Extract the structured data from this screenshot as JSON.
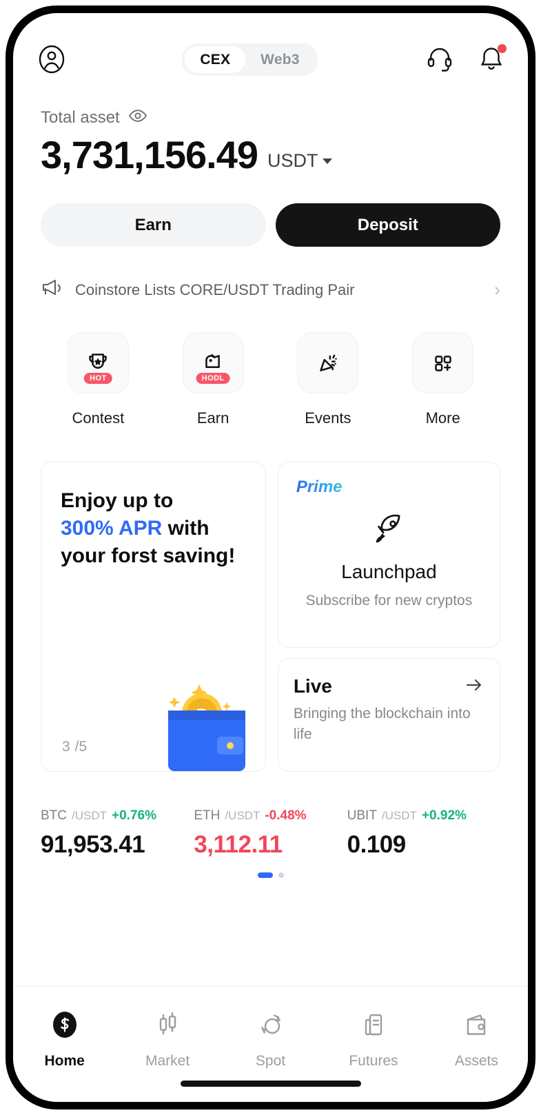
{
  "topbar": {
    "profile_icon": "user-circle-icon",
    "segments": [
      {
        "label": "CEX",
        "active": true
      },
      {
        "label": "Web3",
        "active": false
      }
    ],
    "support_icon": "headset-icon",
    "notification_icon": "bell-icon",
    "notification_badge": true
  },
  "asset": {
    "label": "Total asset",
    "visibility_icon": "eye-icon",
    "amount": "3,731,156.49",
    "currency": "USDT",
    "currency_caret": "chevron-down-icon"
  },
  "actions": {
    "earn_label": "Earn",
    "deposit_label": "Deposit"
  },
  "announcement": {
    "icon": "megaphone-icon",
    "text": "Coinstore Lists CORE/USDT Trading Pair",
    "chevron": "›"
  },
  "quick_actions": [
    {
      "label": "Contest",
      "icon": "trophy-icon",
      "badge": "HOT"
    },
    {
      "label": "Earn",
      "icon": "piggy-bank-icon",
      "badge": "HODL"
    },
    {
      "label": "Events",
      "icon": "party-popper-icon",
      "badge": ""
    },
    {
      "label": "More",
      "icon": "grid-plus-icon",
      "badge": ""
    }
  ],
  "promo_left": {
    "line1": "Enjoy up to",
    "highlight": "300% APR",
    "line2_tail": " with",
    "line3": "your forst saving!",
    "illustration": "wallet-bitcoin-illustration",
    "counter_current": "3",
    "counter_total": "/5"
  },
  "launchpad": {
    "tag": "Prime",
    "icon": "rocket-icon",
    "title": "Launchpad",
    "subtitle": "Subscribe for new cryptos"
  },
  "live": {
    "title": "Live",
    "arrow_icon": "arrow-right-icon",
    "subtitle": "Bringing the blockchain into life"
  },
  "tickers": [
    {
      "base": "BTC",
      "quote": "/USDT",
      "change": "+0.76%",
      "direction": "up",
      "price": "91,953.41"
    },
    {
      "base": "ETH",
      "quote": "/USDT",
      "change": "-0.48%",
      "direction": "down",
      "price": "3,112.11"
    },
    {
      "base": "UBIT",
      "quote": "/USDT",
      "change": "+0.92%",
      "direction": "up",
      "price": "0.109"
    }
  ],
  "carousel": {
    "pages": 2,
    "active_index": 0
  },
  "nav": [
    {
      "label": "Home",
      "icon": "coinstore-logo-icon",
      "active": true
    },
    {
      "label": "Market",
      "icon": "candlestick-icon",
      "active": false
    },
    {
      "label": "Spot",
      "icon": "swap-circles-icon",
      "active": false
    },
    {
      "label": "Futures",
      "icon": "document-chart-icon",
      "active": false
    },
    {
      "label": "Assets",
      "icon": "wallet-icon",
      "active": false
    }
  ],
  "colors": {
    "accent_blue": "#2f6bf6",
    "up_green": "#14b478",
    "down_red": "#f0465a",
    "badge_red": "#f7566a",
    "black": "#141414"
  }
}
